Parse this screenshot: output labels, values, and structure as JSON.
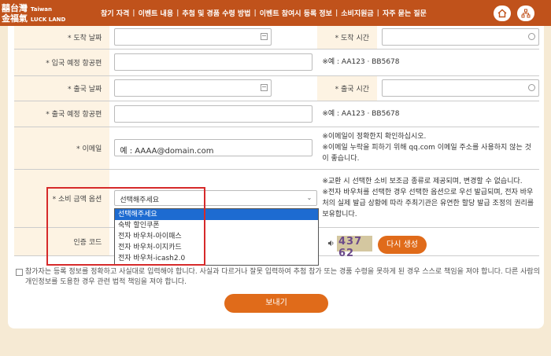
{
  "header": {
    "logo_line1": "囍台灣",
    "logo_sub1": "Taiwan",
    "logo_line2": "金福氣",
    "logo_sub2": "LUCK LAND",
    "nav": [
      "참기 자격",
      "이벤트 내용",
      "추첨 및 경품 수령 방법",
      "이벤트 참여시 등록 정보",
      "소비지원금",
      "자주 묻는 질문"
    ]
  },
  "form": {
    "arrival_date_label": "* 도착 날짜",
    "arrival_time_label": "* 도착 시간",
    "arrival_flight_label": "* 입국 예정 항공편",
    "arrival_flight_note": "※예 : AA123 · BB5678",
    "departure_date_label": "* 출국 날짜",
    "departure_time_label": "* 출국 시간",
    "departure_flight_label": "* 출국 예정 항공편",
    "departure_flight_note": "※예 : AA123 · BB5678",
    "email_label": "* 이메일",
    "email_placeholder": "예 : AAAA@domain.com",
    "email_note1": "※이메일이 정확한지 확인하십시오.",
    "email_note2": "※이메일 누락을 피하기 위해 qq.com 이메일 주소를 사용하지 않는 것이 좋습니다.",
    "amount_label": "* 소비 금액 옵션",
    "amount_selected": "선택해주세요",
    "amount_note1": "※교환 시 선택한 소비 보조금 종류로 제공되며, 변경할 수 없습니다.",
    "amount_note2": "※전자 바우처를 선택한 경우 선택한 옵션으로 우선 발급되며, 전자 바우처의 실제 발급 상황에 따라 주최기관은 유연한 할당 발급 조정의 권리를 보유합니다.",
    "captcha_label": "인증 코드",
    "captcha_text": "437 62",
    "regen_label": "다시 생성"
  },
  "dropdown_options": [
    "선택해주세요",
    "숙박 할인쿠폰",
    "전자 바우처-아이패스",
    "전자 바우처-이지카드",
    "전자 바우처-icash2.0"
  ],
  "agree_text": "참가자는 등록 정보를 정확하고 사실대로 입력해야 합니다. 사실과 다르거나 잘못 입력하여 추첨 참가 또는 경품 수령을 못하게 된 경우 스스로 책임을 져야 합니다. 다른 사람의 개인정보를 도용한 경우 관련 법적 책임을 져야 합니다.",
  "submit_label": "보내기",
  "colors": {
    "header": "#c0521b",
    "accent": "#e06b1a",
    "highlight": "#1d6bd1",
    "annotation": "#d62a2a"
  }
}
